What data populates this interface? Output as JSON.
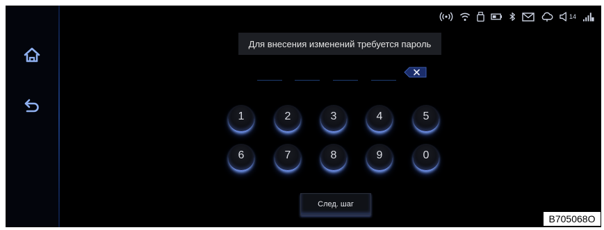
{
  "prompt": {
    "text": "Для внесения изменений требуется пароль"
  },
  "keypad": {
    "keys": [
      "1",
      "2",
      "3",
      "4",
      "5",
      "6",
      "7",
      "8",
      "9",
      "0"
    ]
  },
  "next_button": {
    "label": "След. шаг"
  },
  "status": {
    "volume_level": "14"
  },
  "icons": {
    "home": "home-icon",
    "back": "back-icon",
    "clear": "clear-icon",
    "hotspot": "hotspot-icon",
    "wifi": "wifi-icon",
    "usb": "usb-icon",
    "battery": "battery-icon",
    "bluetooth": "bluetooth-icon",
    "mail": "mail-icon",
    "cloud": "cloud-icon",
    "volume": "volume-icon",
    "signal": "signal-icon"
  },
  "watermark": {
    "code": "B705068O"
  },
  "colors": {
    "background": "#000000",
    "accent_glow": "#6f8fff",
    "text": "#e6e6e6"
  }
}
